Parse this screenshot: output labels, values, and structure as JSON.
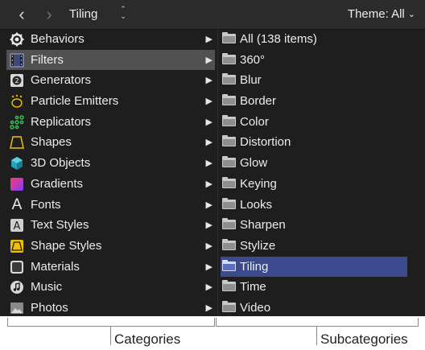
{
  "toolbar": {
    "back_icon": "chevron-left-icon",
    "forward_icon": "chevron-right-icon",
    "breadcrumb": "Tiling",
    "theme_label": "Theme: All"
  },
  "categories": [
    {
      "label": "Behaviors",
      "icon": "gear-icon"
    },
    {
      "label": "Filters",
      "icon": "film-strip-icon",
      "selected": true
    },
    {
      "label": "Generators",
      "icon": "generator-icon"
    },
    {
      "label": "Particle Emitters",
      "icon": "particle-emitter-icon"
    },
    {
      "label": "Replicators",
      "icon": "replicator-icon"
    },
    {
      "label": "Shapes",
      "icon": "shape-icon"
    },
    {
      "label": "3D Objects",
      "icon": "cube-icon"
    },
    {
      "label": "Gradients",
      "icon": "gradient-icon"
    },
    {
      "label": "Fonts",
      "icon": "font-icon"
    },
    {
      "label": "Text Styles",
      "icon": "text-style-icon"
    },
    {
      "label": "Shape Styles",
      "icon": "shape-style-icon"
    },
    {
      "label": "Materials",
      "icon": "material-icon"
    },
    {
      "label": "Music",
      "icon": "music-icon"
    },
    {
      "label": "Photos",
      "icon": "photo-icon"
    }
  ],
  "subcategories": [
    {
      "label": "All (138 items)"
    },
    {
      "label": "360°"
    },
    {
      "label": "Blur"
    },
    {
      "label": "Border"
    },
    {
      "label": "Color"
    },
    {
      "label": "Distortion"
    },
    {
      "label": "Glow"
    },
    {
      "label": "Keying"
    },
    {
      "label": "Looks"
    },
    {
      "label": "Sharpen"
    },
    {
      "label": "Stylize"
    },
    {
      "label": "Tiling",
      "selected": true
    },
    {
      "label": "Time"
    },
    {
      "label": "Video"
    }
  ],
  "annotations": {
    "categories": "Categories",
    "subcategories": "Subcategories"
  },
  "colors": {
    "panel_bg": "#1e1e1e",
    "selected_category": "#515151",
    "selected_subcategory": "#3a4a8c"
  }
}
